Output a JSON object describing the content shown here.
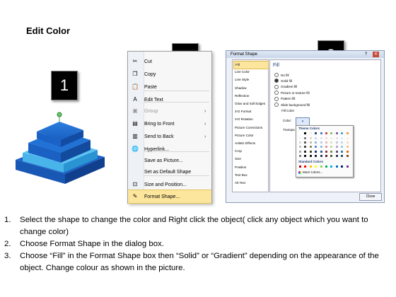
{
  "title": "Edit Color",
  "badges": [
    "1",
    "2",
    "3"
  ],
  "context_menu": {
    "items": [
      {
        "label": "Cut",
        "icon": "scissors-icon",
        "glyph": "✂",
        "disabled": false,
        "submenu": false
      },
      {
        "label": "Copy",
        "icon": "copy-icon",
        "glyph": "❐",
        "disabled": false,
        "submenu": false
      },
      {
        "label": "Paste",
        "icon": "paste-icon",
        "glyph": "📋",
        "disabled": false,
        "submenu": false
      },
      {
        "label": "Edit Text",
        "icon": "edit-text-icon",
        "glyph": "A",
        "disabled": false,
        "submenu": false
      },
      {
        "label": "Group",
        "icon": "group-icon",
        "glyph": "▣",
        "disabled": true,
        "submenu": true
      },
      {
        "label": "Bring to Front",
        "icon": "bring-front-icon",
        "glyph": "▤",
        "disabled": false,
        "submenu": true
      },
      {
        "label": "Send to Back",
        "icon": "send-back-icon",
        "glyph": "▥",
        "disabled": false,
        "submenu": true
      },
      {
        "label": "Hyperlink...",
        "icon": "hyperlink-icon",
        "glyph": "🌐",
        "disabled": false,
        "submenu": false
      },
      {
        "label": "Save as Picture...",
        "icon": "",
        "glyph": "",
        "disabled": false,
        "submenu": false
      },
      {
        "label": "Set as Default Shape",
        "icon": "",
        "glyph": "",
        "disabled": false,
        "submenu": false
      },
      {
        "label": "Size and Position...",
        "icon": "size-position-icon",
        "glyph": "⊡",
        "disabled": false,
        "submenu": false
      },
      {
        "label": "Format Shape...",
        "icon": "format-shape-icon",
        "glyph": "✎",
        "disabled": false,
        "submenu": false,
        "highlighted": true
      }
    ]
  },
  "dialog": {
    "title": "Format Shape",
    "title_buttons": [
      "?",
      "✕"
    ],
    "categories": [
      "Fill",
      "Line Color",
      "Line Style",
      "Shadow",
      "Reflection",
      "Glow and Soft Edges",
      "3-D Format",
      "3-D Rotation",
      "Picture Corrections",
      "Picture Color",
      "Artistic Effects",
      "Crop",
      "Size",
      "Position",
      "Text Box",
      "Alt Text"
    ],
    "selected_category": "Fill",
    "fill_heading": "Fill",
    "fill_options": [
      {
        "label": "No fill",
        "selected": false
      },
      {
        "label": "Solid fill",
        "selected": true
      },
      {
        "label": "Gradient fill",
        "selected": false
      },
      {
        "label": "Picture or texture fill",
        "selected": false
      },
      {
        "label": "Pattern fill",
        "selected": false
      },
      {
        "label": "Slide background fill",
        "selected": false
      }
    ],
    "fill_color_label": "Fill Color",
    "color_label": "Color:",
    "transparency_label": "Transpa",
    "theme_colors_label": "Theme Colors",
    "standard_colors_label": "Standard Colors",
    "more_colors_label": "More Colors...",
    "close_label": "Close",
    "accent_color": "#fce59c"
  },
  "instructions": [
    {
      "n": "1.",
      "text": "Select the shape to change the color and Right click the object( click any object which you want to change color)"
    },
    {
      "n": "2.",
      "text": "Choose Format Shape in the dialog box."
    },
    {
      "n": "3.",
      "text": "Choose “Fill” in the Format Shape box then “Solid” or “Gradient” depending on the appearance of the object. Change colour as shown in the picture."
    }
  ]
}
